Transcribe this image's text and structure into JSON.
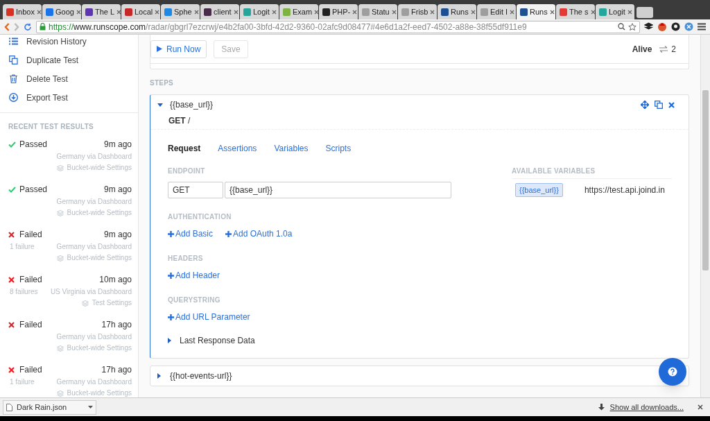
{
  "browser": {
    "tabs": [
      {
        "title": "Inbox",
        "color": "#d93025",
        "selected": false
      },
      {
        "title": "Goog",
        "color": "#1a73e8",
        "selected": false
      },
      {
        "title": "The L",
        "color": "#5e35b1",
        "selected": false
      },
      {
        "title": "Local",
        "color": "#c62828",
        "selected": false
      },
      {
        "title": "Sphe",
        "color": "#1e88e5",
        "selected": false
      },
      {
        "title": "client",
        "color": "#4a2c4a",
        "selected": false
      },
      {
        "title": "Logit",
        "color": "#26a69a",
        "selected": false
      },
      {
        "title": "Exam",
        "color": "#7cb342",
        "selected": false
      },
      {
        "title": "PHP-",
        "color": "#222222",
        "selected": false
      },
      {
        "title": "Statu",
        "color": "#9e9e9e",
        "selected": false
      },
      {
        "title": "Frisb",
        "color": "#9e9e9e",
        "selected": false
      },
      {
        "title": "Runs",
        "color": "#1d4f91",
        "selected": false
      },
      {
        "title": "Edit I",
        "color": "#9e9e9e",
        "selected": false
      },
      {
        "title": "Runs",
        "color": "#1d4f91",
        "selected": true
      },
      {
        "title": "The s",
        "color": "#e53935",
        "selected": false
      },
      {
        "title": "Logit",
        "color": "#26a69a",
        "selected": false
      }
    ],
    "url": {
      "scheme": "https://",
      "host": "www.runscope.com",
      "path": "/radar/gbgrl7ezcrwj/e4b2fa00-3bfd-42d2-9360-02afc9d08477#4e6d1a2f-eed7-4502-a88e-38f55df911e9"
    }
  },
  "sidebar": {
    "actions": [
      {
        "kind": "list",
        "label": "Revision History"
      },
      {
        "kind": "duplicate",
        "label": "Duplicate Test"
      },
      {
        "kind": "trash",
        "label": "Delete Test"
      },
      {
        "kind": "export",
        "label": "Export Test"
      }
    ],
    "recent_title": "RECENT TEST RESULTS",
    "results": [
      {
        "kind": "passed",
        "label": "Passed",
        "time": "9m ago",
        "location": "Germany via Dashboard",
        "settings": "Bucket-wide Settings"
      },
      {
        "kind": "passed",
        "label": "Passed",
        "time": "9m ago",
        "location": "Germany via Dashboard",
        "settings": "Bucket-wide Settings"
      },
      {
        "kind": "failed",
        "label": "Failed",
        "time": "9m ago",
        "failures": "1 failure",
        "location": "Germany via Dashboard",
        "settings": "Bucket-wide Settings"
      },
      {
        "kind": "failed",
        "label": "Failed",
        "time": "10m ago",
        "failures": "8 failures",
        "location": "US Virginia via Dashboard",
        "settings": "Test Settings"
      },
      {
        "kind": "failed",
        "label": "Failed",
        "time": "17h ago",
        "location": "Germany via Dashboard",
        "settings": "Bucket-wide Settings"
      },
      {
        "kind": "failed",
        "label": "Failed",
        "time": "17h ago",
        "failures": "1 failure",
        "location": "Germany via Dashboard",
        "settings": "Bucket-wide Settings"
      }
    ]
  },
  "toolbar": {
    "run": "Run Now",
    "save": {
      "label": "Save",
      "disabled": true
    },
    "status": "Alive",
    "count": "2"
  },
  "steps_title": "STEPS",
  "steps": [
    {
      "name": "{{base_url}}",
      "expanded": true,
      "request": "**GET** /",
      "tabs": [
        {
          "label": "Request",
          "selected": true
        },
        {
          "label": "Assertions",
          "selected": false
        },
        {
          "label": "Variables",
          "selected": false
        },
        {
          "label": "Scripts",
          "selected": false
        }
      ],
      "endpoint_title": "ENDPOINT",
      "method": "GET",
      "endpoint_url": "{{base_url}}",
      "variables_title": "AVAILABLE VARIABLES",
      "variables": [
        {
          "name": "{{base_url}}",
          "value": "https://test.api.joind.in"
        }
      ],
      "sections": [
        {
          "title": "AUTHENTICATION",
          "actions": [
            "Add Basic",
            "Add OAuth 1.0a"
          ]
        },
        {
          "title": "HEADERS",
          "actions": [
            "Add Header"
          ]
        },
        {
          "title": "QUERYSTRING",
          "actions": [
            "Add URL Parameter"
          ]
        }
      ],
      "last_response": "Last Response Data"
    },
    {
      "name": "{{hot-events-url}}",
      "expanded": false
    }
  ],
  "downloads": {
    "file": "Dark Rain.json",
    "show_all": "Show all downloads..."
  }
}
